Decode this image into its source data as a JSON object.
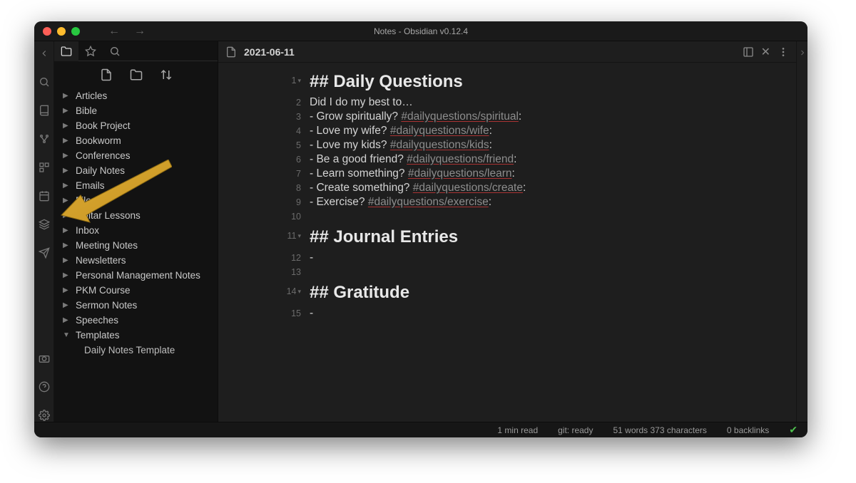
{
  "window": {
    "title": "Notes - Obsidian v0.12.4"
  },
  "note": {
    "title": "2021-06-11"
  },
  "sidebar": {
    "folders": [
      {
        "label": "Articles",
        "expanded": false
      },
      {
        "label": "Bible",
        "expanded": false
      },
      {
        "label": "Book Project",
        "expanded": false
      },
      {
        "label": "Bookworm",
        "expanded": false
      },
      {
        "label": "Conferences",
        "expanded": false
      },
      {
        "label": "Daily Notes",
        "expanded": false
      },
      {
        "label": "Emails",
        "expanded": false
      },
      {
        "label": "Files",
        "expanded": false
      },
      {
        "label": "Guitar Lessons",
        "expanded": false
      },
      {
        "label": "Inbox",
        "expanded": false
      },
      {
        "label": "Meeting Notes",
        "expanded": false
      },
      {
        "label": "Newsletters",
        "expanded": false
      },
      {
        "label": "Personal Management Notes",
        "expanded": false
      },
      {
        "label": "PKM Course",
        "expanded": false
      },
      {
        "label": "Sermon Notes",
        "expanded": false
      },
      {
        "label": "Speeches",
        "expanded": false
      },
      {
        "label": "Templates",
        "expanded": true,
        "children": [
          {
            "label": "Daily Notes Template"
          }
        ]
      }
    ]
  },
  "editor": {
    "lines": [
      {
        "n": "1",
        "fold": true,
        "head": true,
        "text": "## Daily Questions"
      },
      {
        "n": "2",
        "text": "Did I do my best to…"
      },
      {
        "n": "3",
        "prefix": "- Grow spiritually? ",
        "tag": "#dailyquestions/spiritual",
        "suffix": ":"
      },
      {
        "n": "4",
        "prefix": "- Love my wife? ",
        "tag": "#dailyquestions/wife",
        "suffix": ":"
      },
      {
        "n": "5",
        "prefix": "- Love my kids? ",
        "tag": "#dailyquestions/kids",
        "suffix": ":"
      },
      {
        "n": "6",
        "prefix": "- Be a good friend? ",
        "tag": "#dailyquestions/friend",
        "suffix": ":"
      },
      {
        "n": "7",
        "prefix": "- Learn something? ",
        "tag": "#dailyquestions/learn",
        "suffix": ":"
      },
      {
        "n": "8",
        "prefix": "- Create something? ",
        "tag": "#dailyquestions/create",
        "suffix": ":"
      },
      {
        "n": "9",
        "prefix": "- Exercise? ",
        "tag": "#dailyquestions/exercise",
        "suffix": ":"
      },
      {
        "n": "10",
        "text": ""
      },
      {
        "n": "11",
        "fold": true,
        "head": true,
        "text": "## Journal Entries"
      },
      {
        "n": "12",
        "text": "- "
      },
      {
        "n": "13",
        "text": ""
      },
      {
        "n": "14",
        "fold": true,
        "head": true,
        "text": "## Gratitude"
      },
      {
        "n": "15",
        "text": "- "
      }
    ]
  },
  "status": {
    "readtime": "1 min read",
    "git": "git: ready",
    "words": "51 words 373 characters",
    "backlinks": "0 backlinks"
  }
}
